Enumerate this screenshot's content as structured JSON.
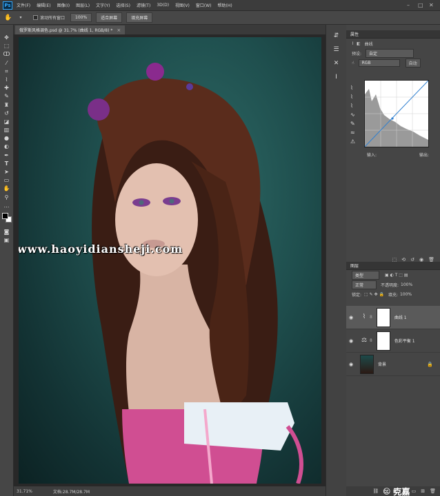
{
  "app": {
    "logo": "Ps"
  },
  "menu": [
    "文件(F)",
    "编辑(E)",
    "图像(I)",
    "图层(L)",
    "文字(Y)",
    "选择(S)",
    "滤镜(T)",
    "3D(D)",
    "视图(V)",
    "窗口(W)",
    "帮助(H)"
  ],
  "options": {
    "scroll_all_label": "滚动所有窗口",
    "zoom_value": "100%",
    "fit_screen": "适合屏幕",
    "fill_screen": "填充屏幕"
  },
  "document": {
    "tab_title": "俄罗斯风格调色.psd @ 31.7% (曲线 1, RGB/8) *",
    "watermark": "www.haoyidiansheji.com"
  },
  "status": {
    "zoom": "31.71%",
    "doc": "文档:28.7M/28.7M"
  },
  "properties": {
    "title": "属性",
    "adjust_name": "曲线",
    "preset_label": "预设:",
    "preset_value": "自定",
    "channel_value": "RGB",
    "auto_label": "自动",
    "input_label": "输入:",
    "output_label": "输出:"
  },
  "layers": {
    "title": "图层",
    "kind": "类型",
    "blend": "正常",
    "opacity_label": "不透明度:",
    "opacity": "100%",
    "lock_label": "锁定:",
    "fill_label": "填充:",
    "fill": "100%",
    "items": [
      {
        "name": "曲线 1",
        "selected": true
      },
      {
        "name": "色彩平衡 1",
        "selected": false
      },
      {
        "name": "背景",
        "selected": false
      }
    ]
  },
  "wechat_badge": {
    "name": "克嘉"
  }
}
